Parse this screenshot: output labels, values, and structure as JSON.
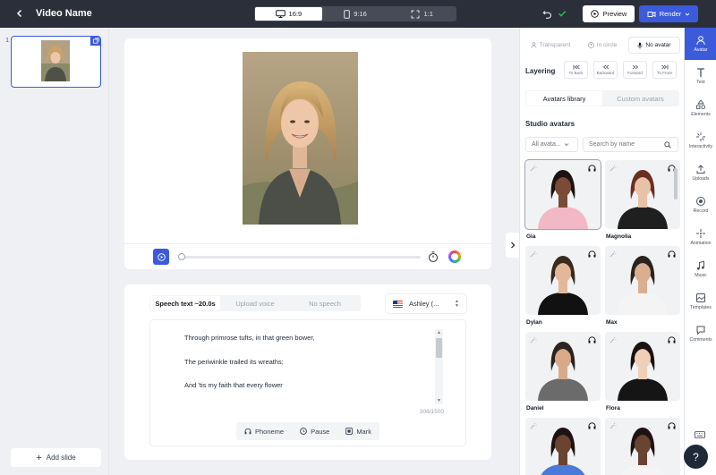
{
  "header": {
    "title": "Video Name",
    "ratios": [
      {
        "label": "16:9",
        "icon": "monitor-icon",
        "active": true
      },
      {
        "label": "9:16",
        "icon": "phone-icon",
        "active": false
      },
      {
        "label": "1:1",
        "icon": "square-frame-icon",
        "active": false
      }
    ],
    "preview_label": "Preview",
    "render_label": "Render"
  },
  "slides": {
    "items": [
      {
        "number": "1"
      }
    ],
    "add_label": "Add slide"
  },
  "speech": {
    "tabs": [
      "Speech text ~20.0s",
      "Upload voice",
      "No speech"
    ],
    "active_tab": 0,
    "voice": "Ashley (...",
    "lines": [
      "Through primrose tufts, in that green bower,",
      "The periwinkle trailed its wreaths;",
      "And 'tis my faith that every flower"
    ],
    "counter": "308/1500",
    "tools": [
      "Phoneme",
      "Pause",
      "Mark"
    ]
  },
  "panel": {
    "modes": [
      "Transparent",
      "In circle",
      "No avatar"
    ],
    "active_mode": 2,
    "layering_label": "Layering",
    "layer_buttons": [
      "To Back",
      "Backward",
      "Forward",
      "To Front"
    ],
    "lib_tabs": [
      "Avatars library",
      "Custom avatars"
    ],
    "studio_label": "Studio avatars",
    "filter_label": "All avata...",
    "search_placeholder": "Search by name",
    "avatars": [
      {
        "name": "Gia",
        "top": "#f2b8c6",
        "hair": "#1c1412",
        "skin": "#7a4b36"
      },
      {
        "name": "Magnolia",
        "top": "#1f1f1f",
        "hair": "#6b2f1f",
        "skin": "#e8c2a8"
      },
      {
        "name": "Dylan",
        "top": "#111111",
        "hair": "#3a2a20",
        "skin": "#e3b89a"
      },
      {
        "name": "Max",
        "top": "#f4f4f4",
        "hair": "#2b2320",
        "skin": "#dcae90"
      },
      {
        "name": "Daniel",
        "top": "#6b6b6b",
        "hair": "#2c2320",
        "skin": "#d9a98a"
      },
      {
        "name": "Flora",
        "top": "#151515",
        "hair": "#1a1210",
        "skin": "#efcfb8"
      },
      {
        "name": "",
        "top": "#4a7bd8",
        "hair": "#1c1412",
        "skin": "#6b4331"
      },
      {
        "name": "",
        "top": "#f4f4f4",
        "hair": "#1c1412",
        "skin": "#6b4331"
      }
    ]
  },
  "rail": [
    {
      "label": "Avatar",
      "icon": "avatar-icon",
      "active": true
    },
    {
      "label": "Text",
      "icon": "text-icon",
      "active": false
    },
    {
      "label": "Elements",
      "icon": "elements-icon",
      "active": false
    },
    {
      "label": "Interactivity",
      "icon": "interactivity-icon",
      "active": false
    },
    {
      "label": "Uploads",
      "icon": "upload-icon",
      "active": false
    },
    {
      "label": "Record",
      "icon": "record-icon",
      "active": false
    },
    {
      "label": "Animation",
      "icon": "animation-icon",
      "active": false
    },
    {
      "label": "Music",
      "icon": "music-icon",
      "active": false
    },
    {
      "label": "Templates",
      "icon": "templates-icon",
      "active": false
    },
    {
      "label": "Comments",
      "icon": "comments-icon",
      "active": false
    }
  ],
  "help_label": "?",
  "colors": {
    "accent": "#3b5bdb",
    "topbar": "#2b2f3a",
    "success": "#22c55e"
  }
}
